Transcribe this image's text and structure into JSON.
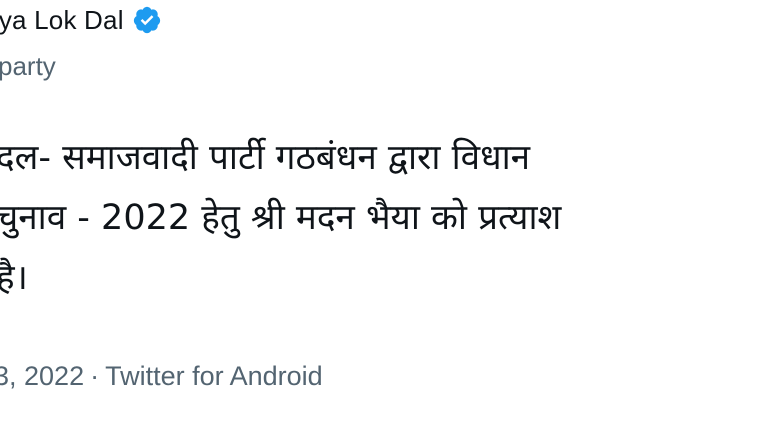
{
  "author": {
    "display_name": "riya Lok Dal",
    "verified": true,
    "subtitle": "party"
  },
  "tweet": {
    "lines": [
      "दल- समाजवादी पार्टी गठबंधन द्वारा विधान",
      "चुनाव - 2022 हेतु श्री मदन भैया को प्रत्याश",
      "है।"
    ]
  },
  "meta": {
    "date": "3, 2022",
    "separator": "·",
    "source": "Twitter for Android"
  },
  "colors": {
    "verified_badge": "#1d9bf0",
    "secondary_text": "#536471",
    "primary_text": "#0f1419"
  },
  "icons": {
    "verified": "verified-badge-icon"
  }
}
